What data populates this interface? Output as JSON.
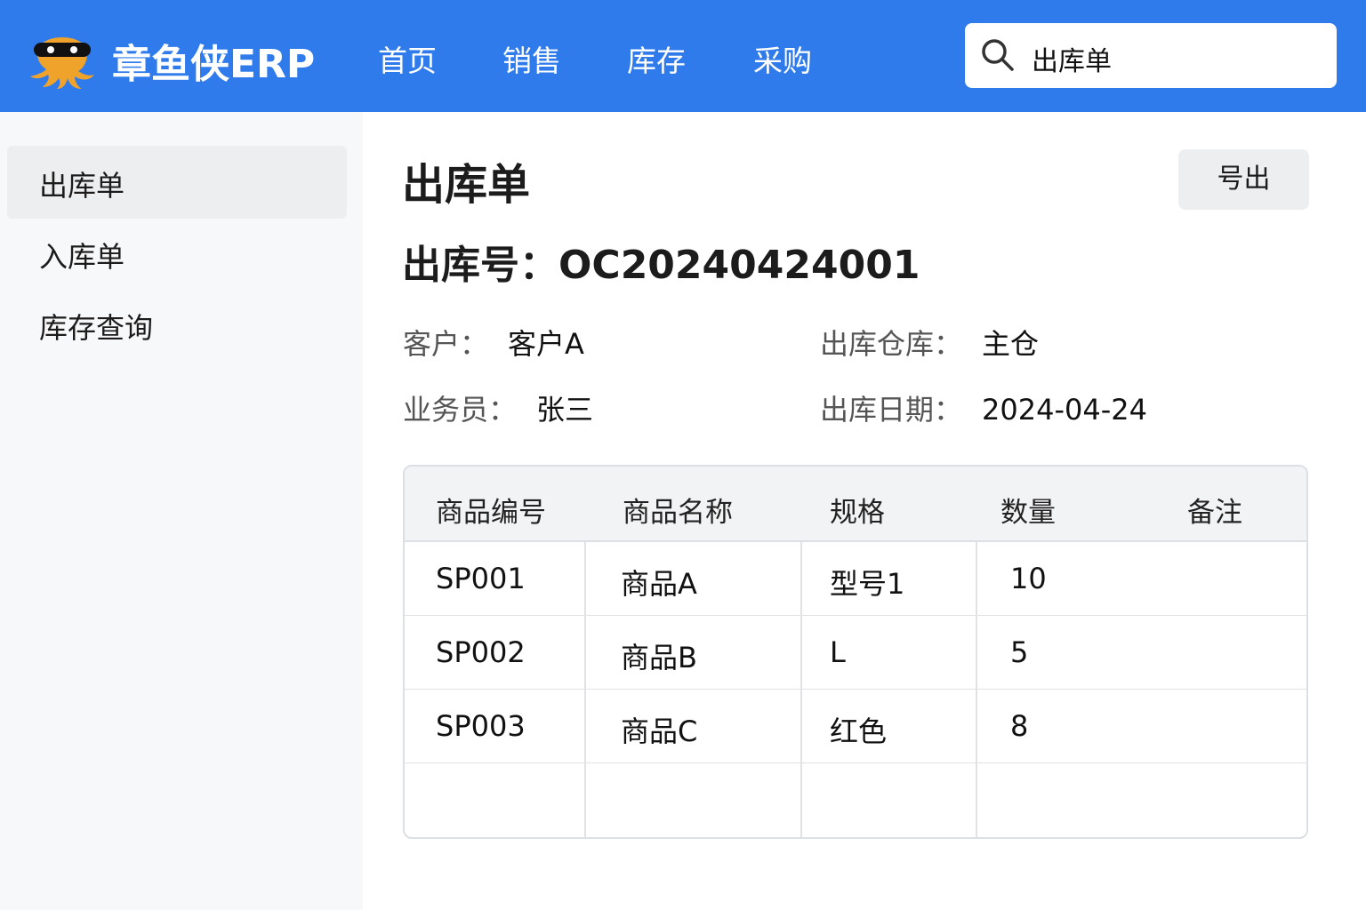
{
  "header": {
    "brand": "章鱼侠ERP",
    "nav": [
      "首页",
      "销售",
      "库存",
      "采购"
    ],
    "search_value": "出库单"
  },
  "sidebar": {
    "items": [
      {
        "label": "出库单",
        "active": true
      },
      {
        "label": "入库单"
      },
      {
        "label": "库存查询"
      }
    ]
  },
  "main": {
    "title": "出库单",
    "export_label": "号出",
    "order_no": "出库号：OC20240424001",
    "fields": {
      "customer_label": "客户：",
      "customer": "客户A",
      "warehouse_label": "出库仓库：",
      "warehouse": "主仓",
      "salesman_label": "业务员：",
      "salesman": "张三",
      "date_label": "出库日期：",
      "date": "2024-04-24"
    },
    "table": {
      "headers": [
        "商品编号",
        "商品名称",
        "规格",
        "数量",
        "备注"
      ],
      "rows": [
        [
          "SP001",
          "商品A",
          "型号1",
          "10"
        ],
        [
          "SP002",
          "商品B",
          "L",
          "5"
        ],
        [
          "SP003",
          "商品C",
          "红色",
          "8"
        ]
      ]
    }
  }
}
